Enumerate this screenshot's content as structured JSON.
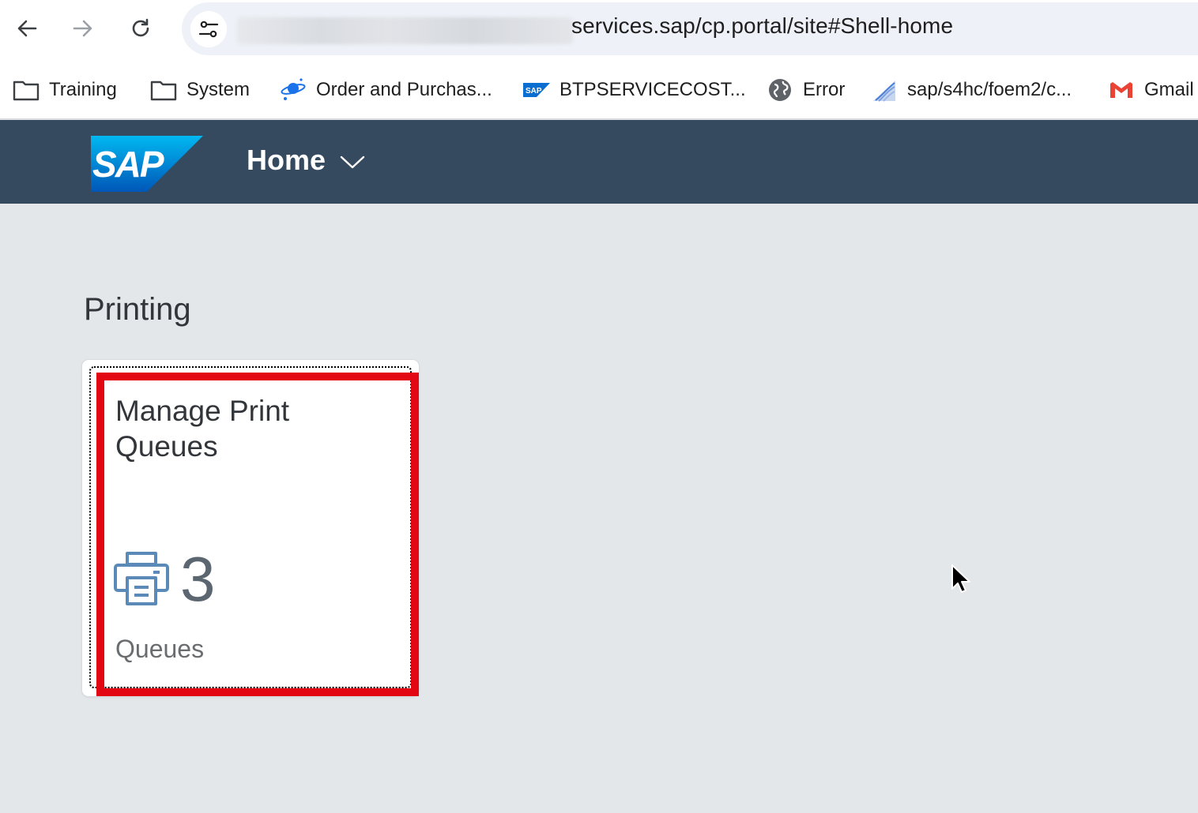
{
  "browser": {
    "url_visible": "services.sap/cp.portal/site#Shell-home",
    "bookmarks": [
      {
        "label": "Training",
        "icon": "folder-icon"
      },
      {
        "label": "System",
        "icon": "folder-icon"
      },
      {
        "label": "Order and Purchas...",
        "icon": "planet-icon"
      },
      {
        "label": "BTPSERVICECOST...",
        "icon": "sap-favicon"
      },
      {
        "label": "Error",
        "icon": "globe-icon"
      },
      {
        "label": "sap/s4hc/foem2/c...",
        "icon": "wave-favicon"
      },
      {
        "label": "Gmail",
        "icon": "gmail-icon"
      }
    ]
  },
  "shell": {
    "logo_text": "SAP",
    "title": "Home",
    "colors": {
      "bar": "#354a5f",
      "logo": "#0a6ed1"
    }
  },
  "page": {
    "group_title": "Printing",
    "tile": {
      "title": "Manage Print Queues",
      "icon": "printer-icon",
      "number": "3",
      "footer": "Queues",
      "highlight_color": "#e30613"
    }
  }
}
